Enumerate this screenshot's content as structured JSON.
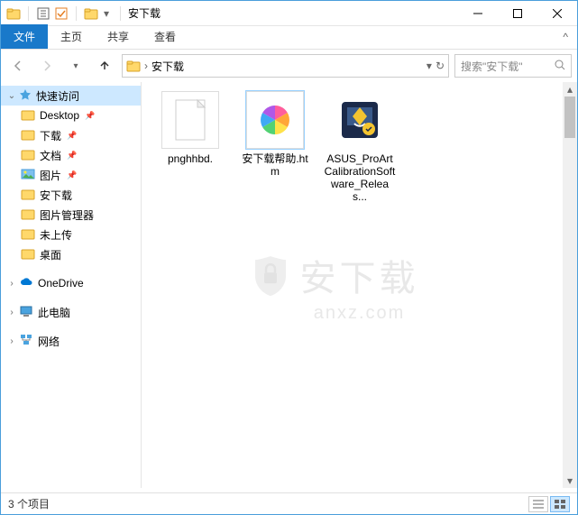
{
  "title": "安下载",
  "ribbon": {
    "tabs": [
      "文件",
      "主页",
      "共享",
      "查看"
    ],
    "expand": "^"
  },
  "nav": {
    "dropdown": "▾"
  },
  "address": {
    "path": "安下载",
    "chev": "›",
    "dd": "▾",
    "refresh": "↻"
  },
  "search": {
    "placeholder": "搜索\"安下载\""
  },
  "sidebar": {
    "quick": "快速访问",
    "items": [
      "Desktop",
      "下载",
      "文档",
      "图片",
      "安下载",
      "图片管理器",
      "未上传",
      "桌面"
    ],
    "onedrive": "OneDrive",
    "pc": "此电脑",
    "network": "网络"
  },
  "files": {
    "a": "pnghhbd.",
    "b": "安下载帮助.htm",
    "c": "ASUS_ProArtCalibrationSoftware_Releas..."
  },
  "watermark": {
    "cn": "安下载",
    "en": "anxz.com"
  },
  "status": {
    "count": "3 个项目"
  }
}
